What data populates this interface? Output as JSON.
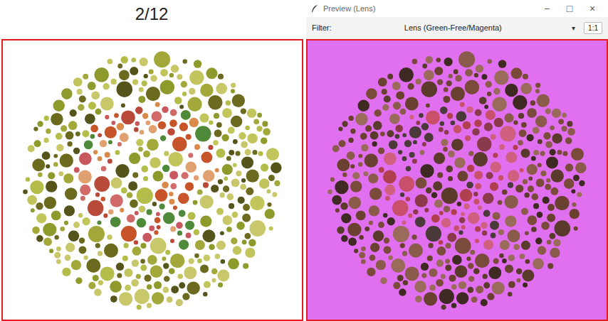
{
  "page": {
    "counter": "2/12"
  },
  "preview_window": {
    "title": "Preview (Lens)",
    "controls": [
      "−",
      "□",
      "×"
    ],
    "toolbar": {
      "filter_label": "Filter:",
      "filter_value": "Lens (Green-Free/Magenta)",
      "dropdown_arrow": "▾",
      "zoom_button": "1:1"
    }
  }
}
